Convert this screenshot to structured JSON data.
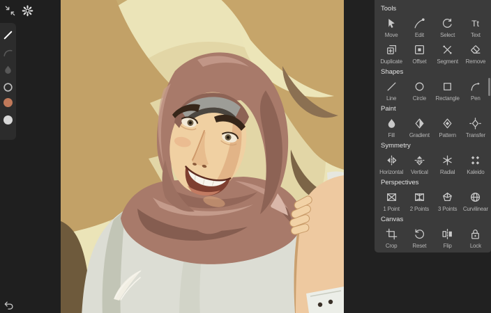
{
  "left_rail": {
    "top_icons": [
      {
        "name": "collapse-icon"
      },
      {
        "name": "gear-icon"
      }
    ],
    "tool_strip": [
      {
        "name": "pen-tool-icon",
        "state": "active"
      },
      {
        "name": "curve-tool-icon",
        "state": "disabled"
      },
      {
        "name": "fill-tool-icon",
        "state": "disabled"
      },
      {
        "name": "stroke-ring-icon",
        "state": "normal"
      },
      {
        "name": "fill-color-swatch",
        "swatch_color": "#c0795a"
      },
      {
        "name": "stroke-color-swatch",
        "swatch_color": "#d8d8d8"
      }
    ],
    "undo": {
      "name": "undo-icon"
    }
  },
  "tool_panel": {
    "background": "#3b3b3b",
    "sections": [
      {
        "title": "Tools",
        "rows": [
          [
            {
              "label": "Move",
              "icon": "move-icon"
            },
            {
              "label": "Edit",
              "icon": "edit-icon"
            },
            {
              "label": "Select",
              "icon": "select-icon"
            },
            {
              "label": "Text",
              "icon": "text-icon"
            }
          ],
          [
            {
              "label": "Duplicate",
              "icon": "duplicate-icon"
            },
            {
              "label": "Offset",
              "icon": "offset-icon"
            },
            {
              "label": "Segment",
              "icon": "segment-icon"
            },
            {
              "label": "Remove",
              "icon": "remove-icon"
            }
          ]
        ]
      },
      {
        "title": "Shapes",
        "rows": [
          [
            {
              "label": "Line",
              "icon": "line-icon"
            },
            {
              "label": "Circle",
              "icon": "circle-icon"
            },
            {
              "label": "Rectangle",
              "icon": "rectangle-icon"
            },
            {
              "label": "Pen",
              "icon": "pen-icon"
            }
          ]
        ]
      },
      {
        "title": "Paint",
        "rows": [
          [
            {
              "label": "Fill",
              "icon": "fill-icon"
            },
            {
              "label": "Gradient",
              "icon": "gradient-icon"
            },
            {
              "label": "Pattern",
              "icon": "pattern-icon"
            },
            {
              "label": "Transfer",
              "icon": "transfer-icon"
            }
          ]
        ]
      },
      {
        "title": "Symmetry",
        "rows": [
          [
            {
              "label": "Horizontal",
              "icon": "horizontal-symmetry-icon"
            },
            {
              "label": "Vertical",
              "icon": "vertical-symmetry-icon"
            },
            {
              "label": "Radial",
              "icon": "radial-symmetry-icon"
            },
            {
              "label": "Kaleido",
              "icon": "kaleido-icon"
            }
          ]
        ]
      },
      {
        "title": "Perspectives",
        "rows": [
          [
            {
              "label": "1 Point",
              "icon": "one-point-icon"
            },
            {
              "label": "2 Points",
              "icon": "two-points-icon"
            },
            {
              "label": "3 Points",
              "icon": "three-points-icon"
            },
            {
              "label": "Curvilinear",
              "icon": "curvilinear-icon"
            }
          ]
        ]
      },
      {
        "title": "Canvas",
        "rows": [
          [
            {
              "label": "Crop",
              "icon": "crop-icon"
            },
            {
              "label": "Reset",
              "icon": "reset-icon"
            },
            {
              "label": "Flip",
              "icon": "flip-icon"
            },
            {
              "label": "Lock",
              "icon": "lock-icon"
            }
          ]
        ]
      }
    ]
  },
  "artwork": {
    "subject": "vector portrait of a smiling woman wearing a hijab",
    "palette": {
      "background_cream": "#ebe4b8",
      "halo_tan": "#dbca97",
      "hair_tan": "#c5a469",
      "hair_shadow": "#8b7052",
      "hijab": "#a87a6a",
      "hijab_shadow": "#7f584b",
      "hijab_light": "#c79e8f",
      "skin": "#f0d0a2",
      "skin_shadow": "#d8a476",
      "garment": "#dcddd4",
      "garment_shadow": "#b9bcac",
      "corner_brown": "#6e5a3c"
    }
  }
}
